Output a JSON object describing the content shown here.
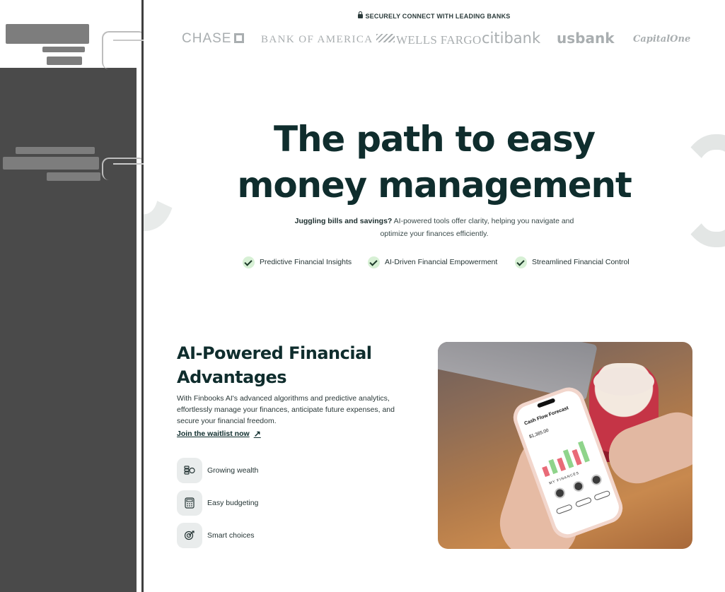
{
  "header": {
    "secure_text": "SECURELY CONNECT WITH LEADING BANKS",
    "banks": [
      "CHASE",
      "BANK OF AMERICA",
      "WELLS FARGO",
      "citibank",
      "usbank",
      "CapitalOne"
    ]
  },
  "hero": {
    "title_line1": "The path to easy",
    "title_line2": "money management",
    "subtitle_bold": "Juggling bills and savings?",
    "subtitle_rest": " AI-powered tools offer clarity, helping you navigate and optimize your finances efficiently.",
    "features": [
      "Predictive Financial Insights",
      "AI-Driven Financial Empowerment",
      "Streamlined Financial Control"
    ]
  },
  "advantages": {
    "title_line1": "AI-Powered Financial",
    "title_line2": "Advantages",
    "body": "With Finbooks AI's advanced algorithms and predictive analytics, effortlessly manage your finances, anticipate future expenses, and secure your financial freedom.",
    "cta": "Join the waitlist now",
    "items": [
      {
        "label": "Growing wealth",
        "icon": "coins-icon"
      },
      {
        "label": "Easy budgeting",
        "icon": "calculator-icon"
      },
      {
        "label": "Smart choices",
        "icon": "target-icon"
      }
    ]
  },
  "phone_screen": {
    "title": "Cash Flow Forecast",
    "amount": "$1,385.00",
    "section": "MY FINANCES"
  },
  "colors": {
    "primary": "#0f2d2d",
    "check_bg": "#d7f0d5",
    "bank_logo": "#a9aeb0",
    "icon_bg": "#e9ecec"
  }
}
